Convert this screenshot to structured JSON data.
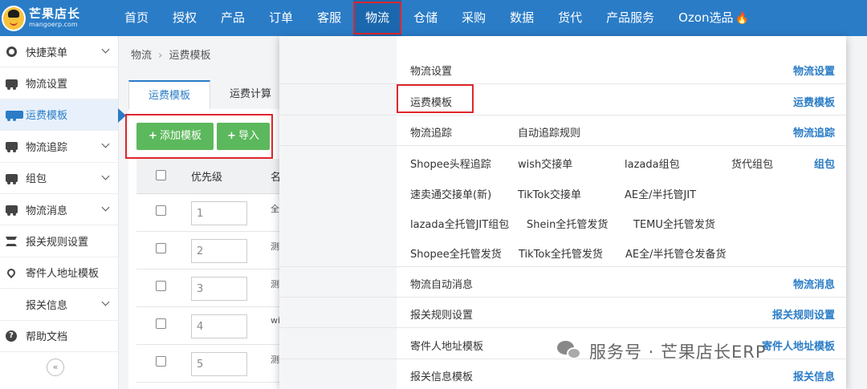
{
  "logo": {
    "cn": "芒果店长",
    "en": "mangoerp.com"
  },
  "nav": [
    {
      "label": "首页"
    },
    {
      "label": "授权"
    },
    {
      "label": "产品"
    },
    {
      "label": "订单"
    },
    {
      "label": "客服"
    },
    {
      "label": "物流",
      "active": true
    },
    {
      "label": "仓储"
    },
    {
      "label": "采购"
    },
    {
      "label": "数据"
    },
    {
      "label": "货代"
    },
    {
      "label": "产品服务"
    },
    {
      "label": "Ozon选品"
    }
  ],
  "sidebar": {
    "items": [
      {
        "label": "快捷菜单",
        "icon": "gear-icon",
        "expand": true
      },
      {
        "label": "物流设置",
        "icon": "truck-icon"
      },
      {
        "label": "运费模板",
        "icon": "truck-icon",
        "active": true
      },
      {
        "label": "物流追踪",
        "icon": "truck-icon",
        "expand": true
      },
      {
        "label": "组包",
        "icon": "truck-icon",
        "expand": true
      },
      {
        "label": "物流消息",
        "icon": "truck-icon",
        "expand": true
      },
      {
        "label": "报关规则设置",
        "icon": "bank-icon"
      },
      {
        "label": "寄件人地址模板",
        "icon": "location-pin-icon"
      },
      {
        "label": "报关信息",
        "icon": "",
        "expand": true
      },
      {
        "label": "帮助文档",
        "icon": "help-icon"
      }
    ],
    "collapse_label": "«"
  },
  "breadcrumb": {
    "root": "物流",
    "current": "运费模板"
  },
  "tabs": [
    {
      "label": "运费模板",
      "active": true
    },
    {
      "label": "运费计算"
    }
  ],
  "toolbar": {
    "add_label": "添加模板",
    "import_label": "导入"
  },
  "table": {
    "headers": {
      "priority": "优先级",
      "name": "名"
    },
    "rows": [
      {
        "priority": "1",
        "name": "全"
      },
      {
        "priority": "2",
        "name": "测"
      },
      {
        "priority": "3",
        "name": "测"
      },
      {
        "priority": "4",
        "name": "wi"
      },
      {
        "priority": "5",
        "name": "测"
      }
    ]
  },
  "dropdown": {
    "categories": {
      "logistics_settings": "物流设置",
      "freight_template": "运费模板",
      "logistics_tracking": "物流追踪",
      "packaging": "组包",
      "logistics_message": "物流消息",
      "customs_rules": "报关规则设置",
      "sender_address": "寄件人地址模板",
      "customs_info": "报关信息"
    },
    "links": {
      "logistics_settings": "物流设置",
      "freight_template": "运费模板",
      "tracking": "物流追踪",
      "auto_tracking_rules": "自动追踪规则",
      "shopee_first_leg": "Shopee头程追踪",
      "wish_handover": "wish交接单",
      "lazada_pack": "lazada组包",
      "forwarder_pack": "货代组包",
      "aliexpress_handover": "速卖通交接单(新)",
      "tiktok_handover": "TikTok交接单",
      "ae_managed_jit": "AE全/半托管JIT",
      "lazada_managed_jit": "lazada全托管JIT组包",
      "shein_managed": "Shein全托管发货",
      "temu_managed": "TEMU全托管发货",
      "shopee_managed": "Shopee全托管发货",
      "tiktok_managed": "TikTok全托管发货",
      "ae_managed_warehouse": "AE全/半托管仓发备货",
      "auto_message": "物流自动消息",
      "customs_rules": "报关规则设置",
      "sender_address": "寄件人地址模板",
      "customs_info_template": "报关信息模板"
    }
  },
  "watermark": {
    "text": "服务号 · 芒果店长ERP"
  },
  "colors": {
    "primary": "#2a7cc7",
    "green": "#5cb85c",
    "highlight_red": "#e0262b"
  }
}
